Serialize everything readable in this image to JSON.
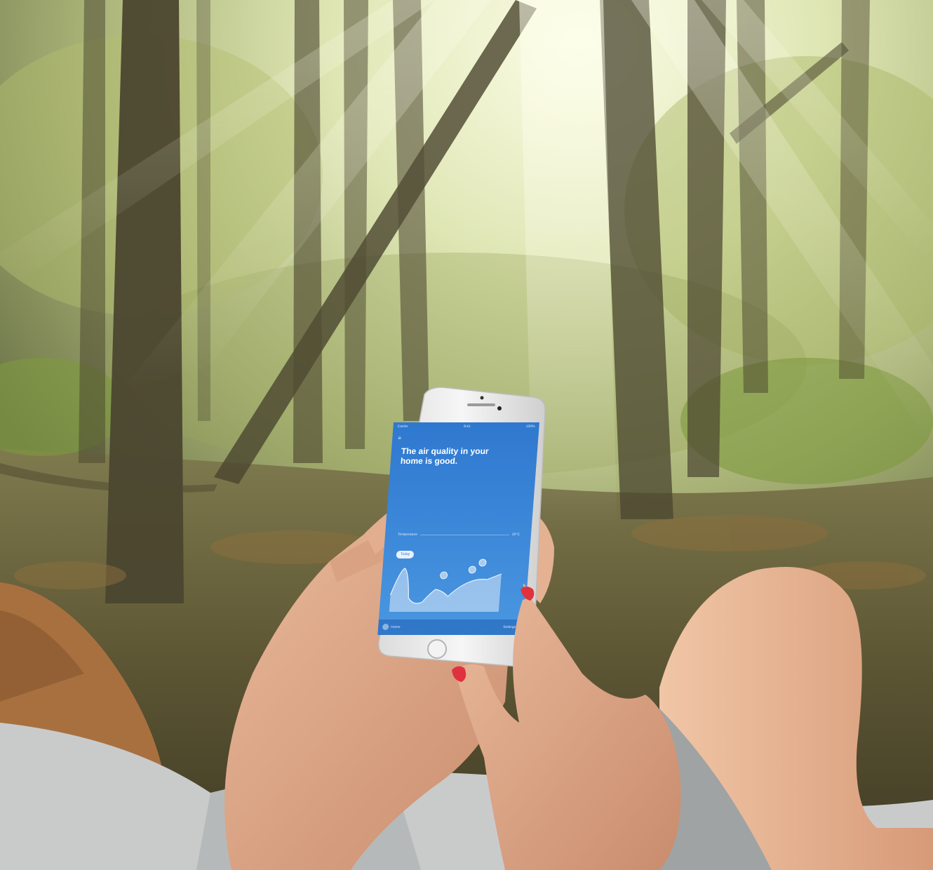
{
  "phone_app": {
    "status_left": "Carrier",
    "status_center": "9:41",
    "status_right": "100%",
    "menu_icon": "menu-icon",
    "headline": "The air quality in your home is good.",
    "temperature_label": "Temperature",
    "temperature_right": "20°C",
    "pill_label": "Today",
    "chart_icon": "pollutant-marker-icon",
    "bottom_left": "Home",
    "bottom_right": "Settings"
  },
  "colors": {
    "screen_top": "#2f78cf",
    "screen_bottom": "#4a97e0",
    "nail_polish": "#e0323e"
  }
}
